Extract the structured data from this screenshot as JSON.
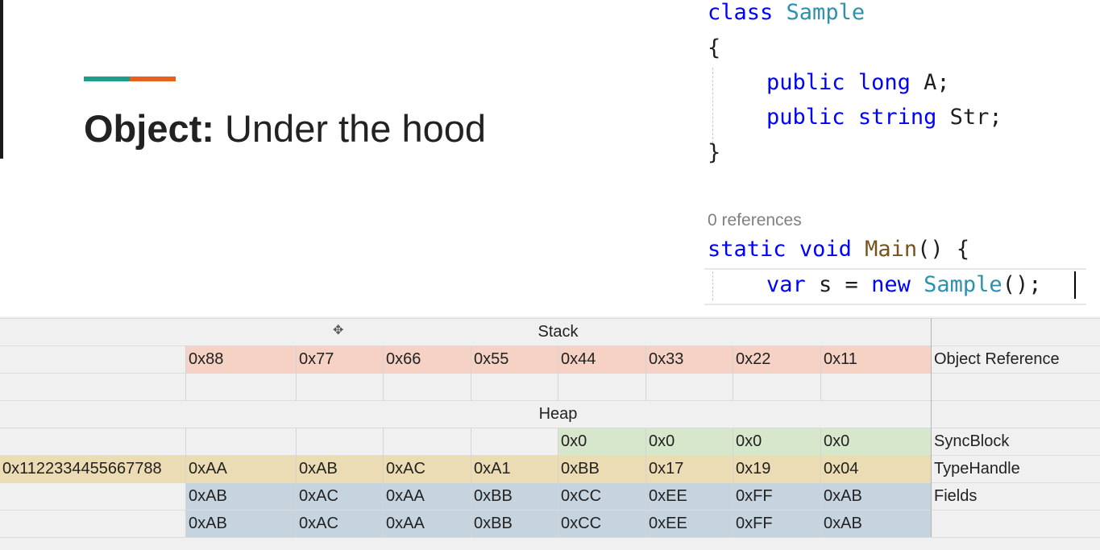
{
  "slide": {
    "title_bold": "Object:",
    "title_rest": " Under the hood"
  },
  "colors": {
    "accent_teal": "#1f9d8a",
    "accent_orange": "#e8601c",
    "stack_row": "#f5d2c4",
    "sync_row": "#d6e7cc",
    "typehandle_row": "#ecdcb4",
    "fields_row": "#c6d4e0",
    "keyword": "#0000ff",
    "type": "#2b91af",
    "method": "#74531f"
  },
  "code": {
    "line1_kw": "class",
    "line1_type": "Sample",
    "open_brace": "{",
    "field1_kw1": "public",
    "field1_kw2": "long",
    "field1_rest": "A;",
    "field2_kw1": "public",
    "field2_kw2": "string",
    "field2_rest": "Str;",
    "close_brace": "}",
    "references": "0 references",
    "main_kw1": "static",
    "main_kw2": "void",
    "main_fn": "Main",
    "main_rest": "() {",
    "body_kw": "var",
    "body_mid": "s =",
    "body_new": "new",
    "body_type": "Sample",
    "body_rest": "();"
  },
  "grid": {
    "stack_header": "Stack",
    "heap_header": "Heap",
    "move_icon": "move-cursor-icon",
    "stack": {
      "values": [
        "0x88",
        "0x77",
        "0x66",
        "0x55",
        "0x44",
        "0x33",
        "0x22",
        "0x11"
      ],
      "label": "Object Reference"
    },
    "syncblock": {
      "values": [
        "0x0",
        "0x0",
        "0x0",
        "0x0"
      ],
      "label": "SyncBlock"
    },
    "typehandle": {
      "address": "0x1122334455667788",
      "values": [
        "0xAA",
        "0xAB",
        "0xAC",
        "0xA1",
        "0xBB",
        "0x17",
        "0x19",
        "0x04"
      ],
      "label": "TypeHandle"
    },
    "fields": {
      "row1": [
        "0xAB",
        "0xAC",
        "0xAA",
        "0xBB",
        "0xCC",
        "0xEE",
        "0xFF",
        "0xAB"
      ],
      "row2": [
        "0xAB",
        "0xAC",
        "0xAA",
        "0xBB",
        "0xCC",
        "0xEE",
        "0xFF",
        "0xAB"
      ],
      "label": "Fields"
    }
  }
}
